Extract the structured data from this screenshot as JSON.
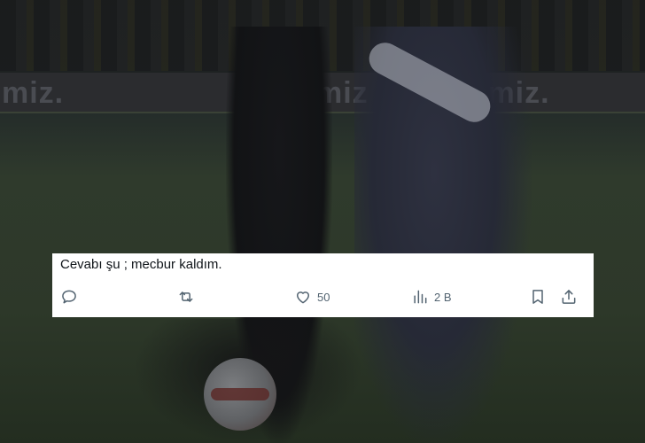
{
  "tweet": {
    "text": "Cevabı şu ; mecbur kaldım.",
    "reply_icon": "reply-icon",
    "retweet_icon": "retweet-icon",
    "like_icon": "heart-icon",
    "like_count": "50",
    "views_icon": "bar-chart-icon",
    "views_count": "2 B",
    "bookmark_icon": "bookmark-icon",
    "share_icon": "share-icon"
  },
  "background": {
    "ad_left": "miz.",
    "ad_middle": "urmiz",
    "ad_right": "imiz."
  },
  "colors": {
    "card_bg": "#ffffff",
    "text": "#0f1419",
    "icon_gray": "#536471"
  }
}
